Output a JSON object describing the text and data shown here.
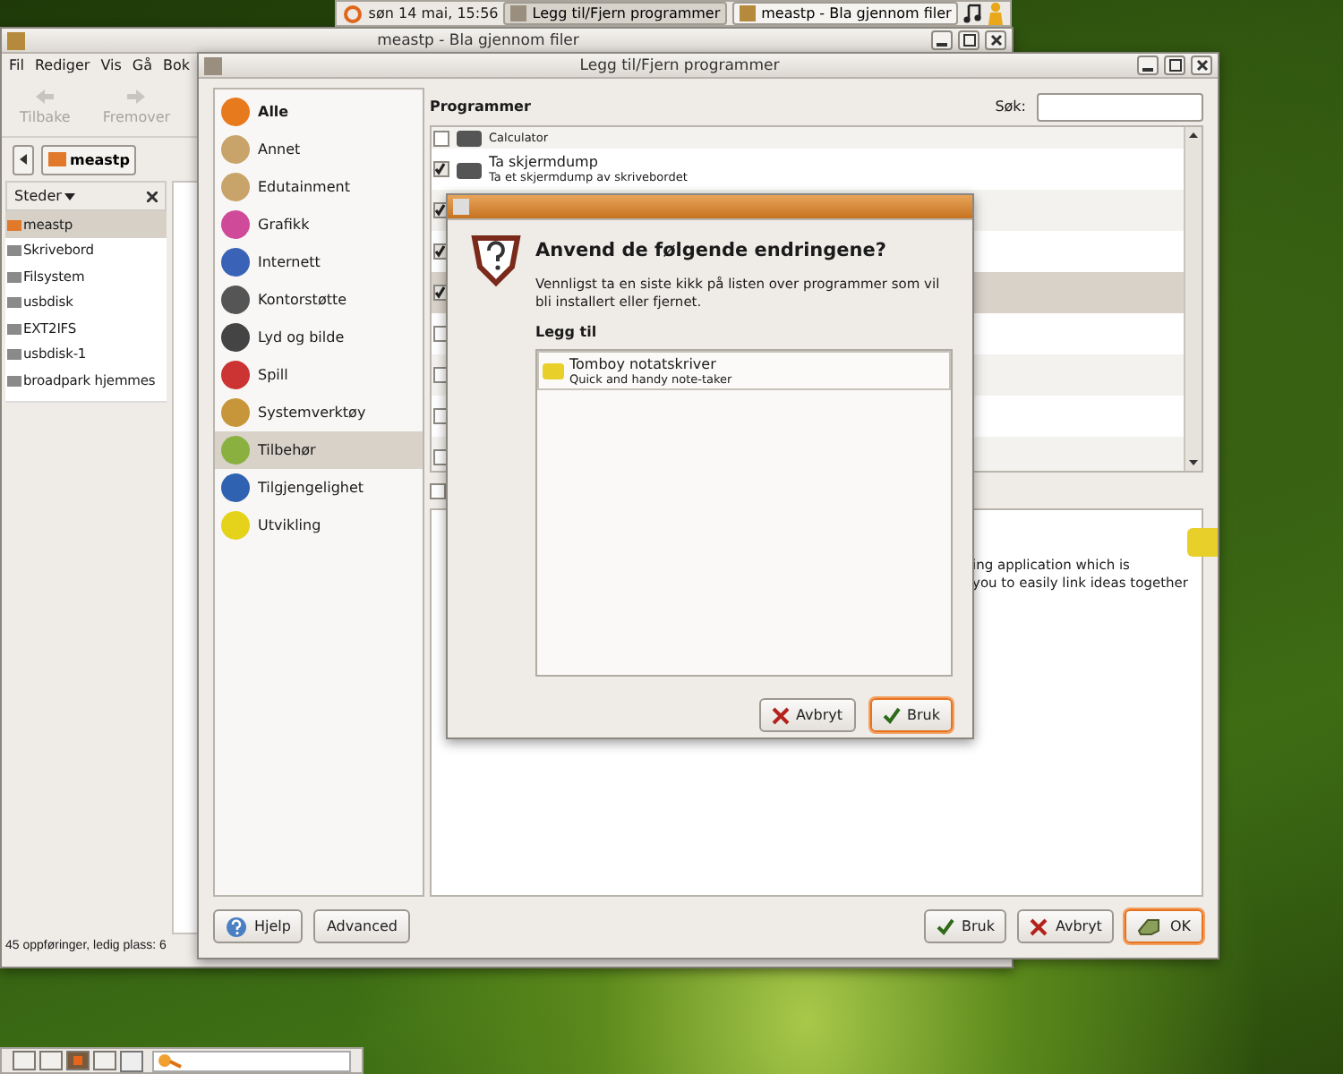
{
  "top_panel": {
    "clock": "søn 14 mai, 15:56",
    "tasks": [
      {
        "label": "Legg til/Fjern programmer",
        "selected": true
      },
      {
        "label": "meastp - Bla gjennom filer",
        "selected": false
      }
    ]
  },
  "file_manager": {
    "title": "meastp - Bla gjennom filer",
    "menu": [
      "Fil",
      "Rediger",
      "Vis",
      "Gå",
      "Bok"
    ],
    "toolbar": [
      {
        "label": "Tilbake",
        "disabled": true
      },
      {
        "label": "Fremover",
        "disabled": true
      }
    ],
    "location": "meastp",
    "sidebar": {
      "header": "Steder",
      "items": [
        {
          "label": "meastp",
          "selected": true
        },
        {
          "label": "Skrivebord",
          "selected": false
        },
        {
          "label": "Filsystem",
          "selected": false
        },
        {
          "label": "usbdisk",
          "selected": false
        },
        {
          "label": "EXT2IFS",
          "selected": false
        },
        {
          "label": "usbdisk-1",
          "selected": false
        },
        {
          "label": "broadpark hjemmes",
          "selected": false
        }
      ]
    },
    "status": "45 oppføringer, ledig plass: 6"
  },
  "add_remove": {
    "title": "Legg til/Fjern programmer",
    "categories": [
      {
        "label": "Alle",
        "kind": "all",
        "selected": false
      },
      {
        "label": "Annet",
        "kind": "category",
        "selected": false
      },
      {
        "label": "Edutainment",
        "kind": "category",
        "selected": false
      },
      {
        "label": "Grafikk",
        "kind": "category",
        "selected": false
      },
      {
        "label": "Internett",
        "kind": "category",
        "selected": false
      },
      {
        "label": "Kontorstøtte",
        "kind": "category",
        "selected": false
      },
      {
        "label": "Lyd og bilde",
        "kind": "category",
        "selected": false
      },
      {
        "label": "Spill",
        "kind": "category",
        "selected": false
      },
      {
        "label": "Systemverktøy",
        "kind": "category",
        "selected": false
      },
      {
        "label": "Tilbehør",
        "kind": "category",
        "selected": true
      },
      {
        "label": "Tilgjengelighet",
        "kind": "category",
        "selected": false
      },
      {
        "label": "Utvikling",
        "kind": "category",
        "selected": false
      }
    ],
    "programs_label": "Programmer",
    "search_label": "Søk:",
    "programs": [
      {
        "description": "Calculator",
        "checked": false,
        "selected": false
      },
      {
        "name": "Ta skjermdump",
        "description": "Ta et skjermdump av skrivebordet",
        "checked": true,
        "selected": false
      },
      {
        "checked": true,
        "selected": false
      },
      {
        "checked": true,
        "selected": false
      },
      {
        "checked": true,
        "selected": true
      },
      {
        "checked": false,
        "selected": false
      },
      {
        "checked": false,
        "selected": false
      },
      {
        "checked": false,
        "selected": false
      },
      {
        "checked": false,
        "selected": false
      }
    ],
    "extra_checkbox": {
      "checked": false
    },
    "description": [
      "ing application which is",
      "you to easily link ideas together"
    ],
    "left_buttons": [
      {
        "label": "Hjelp",
        "kind": "help",
        "focused": false
      },
      {
        "label": "Advanced",
        "kind": "plain",
        "focused": false
      }
    ],
    "right_buttons": [
      {
        "label": "Bruk",
        "kind": "apply",
        "focused": false
      },
      {
        "label": "Avbryt",
        "kind": "cancel",
        "focused": false
      },
      {
        "label": "OK",
        "kind": "ok",
        "focused": true
      }
    ]
  },
  "dialog": {
    "heading": "Anvend de følgende endringene?",
    "message": "Vennligst ta en siste kikk på listen over programmer som vil bli installert eller fjernet.",
    "section": "Legg til",
    "items": [
      {
        "name": "Tomboy notatskriver",
        "description": "Quick and handy note-taker"
      }
    ],
    "buttons": [
      {
        "label": "Avbryt",
        "kind": "cancel",
        "focused": false
      },
      {
        "label": "Bruk",
        "kind": "apply",
        "focused": true
      }
    ]
  },
  "bottom_panel": {
    "workspaces": [
      {
        "selected": false
      },
      {
        "selected": false
      },
      {
        "selected": true
      },
      {
        "selected": false
      }
    ]
  }
}
